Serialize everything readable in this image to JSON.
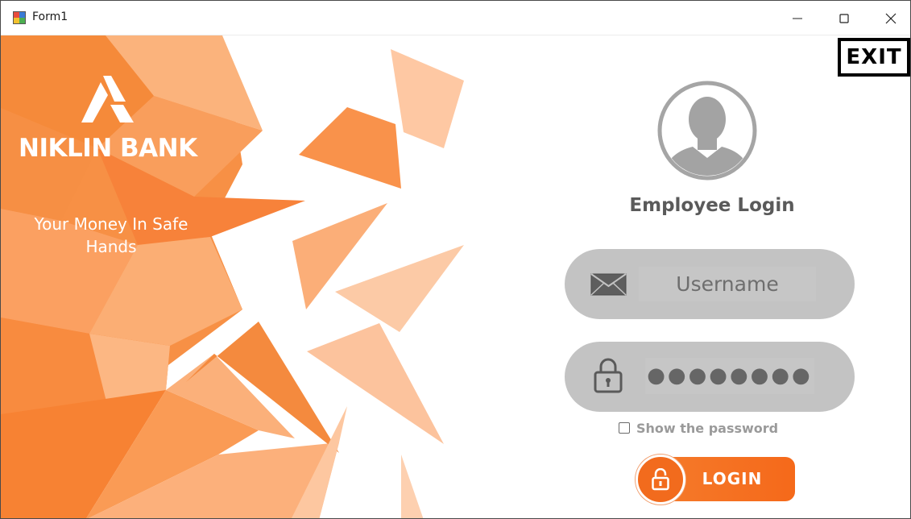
{
  "window": {
    "title": "Form1",
    "controls": [
      "minimize-icon",
      "maximize-icon",
      "close-icon"
    ]
  },
  "brand": {
    "name": "NIKLIN BANK",
    "tagline": "Your Money In Safe\nHands",
    "logo": "axis-triangle-logo"
  },
  "exit_label": "EXIT",
  "login": {
    "title": "Employee Login",
    "avatar_icon": "user-silhouette-icon",
    "username_placeholder": "Username",
    "username_icon": "envelope-icon",
    "password_masked": "●●●●●●●●",
    "password_icon": "padlock-icon",
    "show_password_label": "Show the password",
    "show_password_checked": false,
    "button_label": "LOGIN",
    "button_icon": "unlock-icon"
  },
  "colors": {
    "accent": "#f47a2b",
    "accent_dark": "#f26b1d",
    "field_bg": "#c3c3c3",
    "title_text": "#5a5a5a",
    "avatar_gray": "#a3a3a3"
  }
}
